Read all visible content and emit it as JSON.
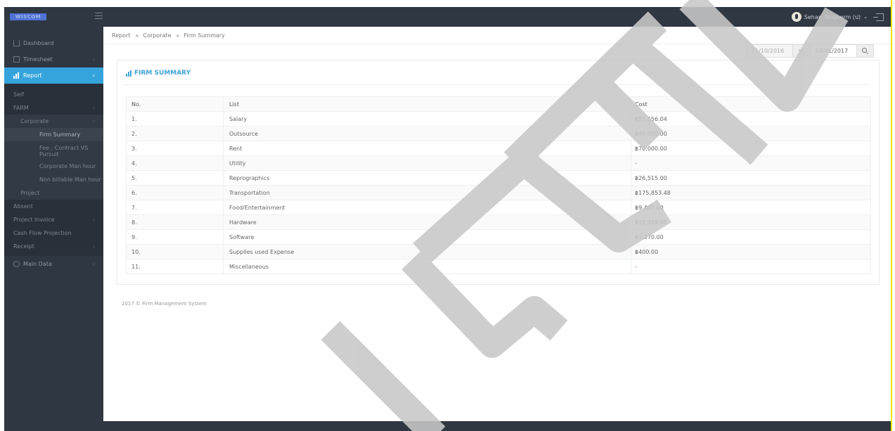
{
  "app": {
    "logo_text": "WISCOM",
    "user_name": "Sehan Yangserm (ป)",
    "user_caret": "⌄"
  },
  "sidebar": {
    "items": [
      {
        "label": "Dashboard"
      },
      {
        "label": "Timesheet",
        "chevron": "‹"
      },
      {
        "label": "Report",
        "chevron": "‹"
      }
    ],
    "report_sub": [
      {
        "label": "Self"
      },
      {
        "label": "FARM",
        "chevron": "‹"
      },
      {
        "label": "Corporate",
        "chevron": "‹"
      },
      {
        "label": "Firm Summary"
      },
      {
        "label": "Fee : Contract VS Pursuit"
      },
      {
        "label": "Corporate Man hour"
      },
      {
        "label": "Non billable Man hour"
      },
      {
        "label": "Project"
      },
      {
        "label": "Absent"
      },
      {
        "label": "Project Invoice",
        "chevron": "‹"
      },
      {
        "label": "Cash Flow Projection"
      },
      {
        "label": "Receipt",
        "chevron": "‹"
      }
    ],
    "main_data": {
      "label": "Main Data",
      "chevron": "‹"
    }
  },
  "breadcrumb": [
    "Report",
    "Corporate",
    "Firm Summary"
  ],
  "date_filter": {
    "from": "01/10/2016",
    "to_label": "to",
    "to": "04/01/2017"
  },
  "panel": {
    "title": "FIRM SUMMARY",
    "columns": [
      "No.",
      "List",
      "Cost"
    ],
    "rows": [
      [
        "1.",
        "Salary",
        "฿55,556.04"
      ],
      [
        "2.",
        "Outsource",
        "฿40,000.00"
      ],
      [
        "3.",
        "Rent",
        "฿70,000.00"
      ],
      [
        "4.",
        "Utility",
        "-"
      ],
      [
        "5.",
        "Reprographics",
        "฿26,515.00"
      ],
      [
        "6.",
        "Transportation",
        "฿175,853.48"
      ],
      [
        "7.",
        "Food/Entertainment",
        "฿9,445.00"
      ],
      [
        "8.",
        "Hardware",
        "฿15,019.00"
      ],
      [
        "9.",
        "Software",
        "฿3,370.00"
      ],
      [
        "10.",
        "Supplies used Expense",
        "฿400.00"
      ],
      [
        "11.",
        "Miscellaneous",
        "-"
      ]
    ]
  },
  "footer": {
    "text": "2017 © Firm Management System"
  },
  "colors": {
    "sidebar_bg": "#2f3742",
    "accent": "#36a4dc",
    "watermark": "#c8c8c8"
  }
}
